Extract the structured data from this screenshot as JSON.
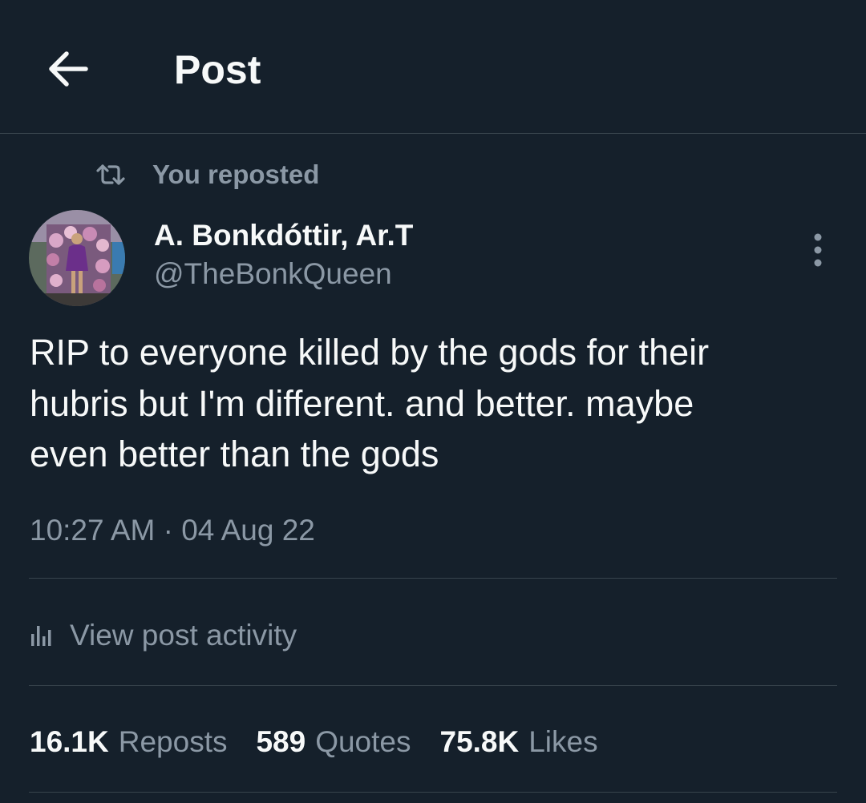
{
  "header": {
    "back_icon": "arrow-left-icon",
    "title": "Post"
  },
  "repost": {
    "icon": "repost-icon",
    "label": "You reposted"
  },
  "author": {
    "avatar_icon": "avatar",
    "name": "A. Bonkdóttir, Ar.T",
    "handle": "@TheBonkQueen",
    "more_icon": "more-vertical-icon"
  },
  "post": {
    "lines": [
      "RIP to everyone killed by the gods for their",
      "hubris but I'm different. and better. maybe",
      "even better than the gods"
    ],
    "timestamp": "10:27 AM · 04 Aug 22"
  },
  "activity": {
    "icon": "analytics-icon",
    "label": "View post activity"
  },
  "stats": {
    "reposts_count": "16.1K",
    "reposts_label": "Reposts",
    "quotes_count": "589",
    "quotes_label": "Quotes",
    "likes_count": "75.8K",
    "likes_label": "Likes"
  },
  "colors": {
    "background": "#15202b",
    "primary_text": "#f7f9f9",
    "secondary_text": "#8b98a5",
    "divider": "#38444d"
  }
}
